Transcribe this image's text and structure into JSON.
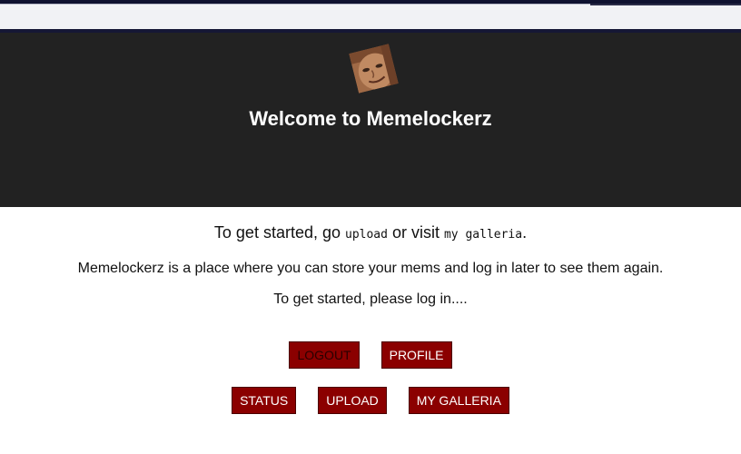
{
  "hero": {
    "title": "Welcome to Memelockerz",
    "avatar_icon": "meme-face-avatar-icon"
  },
  "intro": {
    "prefix": "To get started, go ",
    "upload_code": "upload",
    "middle": " or visit ",
    "galleria_code": "my galleria",
    "suffix": "."
  },
  "description": "Memelockerz is a place where you can store your mems and log in later to see them again.",
  "prompt": "To get started, please log in....",
  "buttons": {
    "logout": "LOGOUT",
    "profile": "PROFILE",
    "status": "STATUS",
    "upload": "UPLOAD",
    "galleria": "MY GALLERIA"
  },
  "colors": {
    "hero_bg": "#222222",
    "button_bg": "#8b0000",
    "button_text": "#ffffff"
  }
}
